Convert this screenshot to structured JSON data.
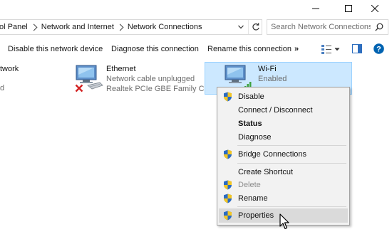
{
  "window": {
    "controls": [
      "minimize",
      "maximize",
      "close"
    ]
  },
  "address": {
    "breadcrumbs": [
      "ol Panel",
      "Network and Internet",
      "Network Connections"
    ],
    "refresh_icon": "refresh-icon",
    "dropdown_icon": "chevron-down-icon"
  },
  "search": {
    "placeholder": "Search Network Connections",
    "icon": "search-icon"
  },
  "toolbar": {
    "disable": "Disable this network device",
    "diagnose": "Diagnose this connection",
    "rename": "Rename this connection",
    "more": "»",
    "icons": [
      "change-view-icon",
      "preview-pane-icon",
      "help-icon"
    ]
  },
  "connections": [
    {
      "title": "twork",
      "sub": "d"
    },
    {
      "title": "Ethernet",
      "status": "Network cable unplugged",
      "device": "Realtek PCIe GBE Family Co...",
      "icon": "ethernet-adapter-icon",
      "badge": "disconnected-x-icon"
    },
    {
      "title": "Wi-Fi",
      "status": "Enabled",
      "icon": "wifi-adapter-icon",
      "selected": true
    }
  ],
  "context_menu": {
    "items": [
      {
        "label": "Disable",
        "shield": true
      },
      {
        "label": "Connect / Disconnect",
        "shield": false
      },
      {
        "label": "Status",
        "shield": false,
        "bold": true
      },
      {
        "label": "Diagnose",
        "shield": false
      },
      {
        "label": "Bridge Connections",
        "shield": true
      },
      {
        "label": "Create Shortcut",
        "shield": false
      },
      {
        "label": "Delete",
        "shield": true,
        "disabled": true
      },
      {
        "label": "Rename",
        "shield": true
      },
      {
        "label": "Properties",
        "shield": true,
        "highlighted": true
      }
    ]
  },
  "colors": {
    "selection": "#cce8ff",
    "selection_border": "#99d1ff",
    "help_blue": "#0063b1",
    "menu_bg": "#f2f2f2"
  }
}
